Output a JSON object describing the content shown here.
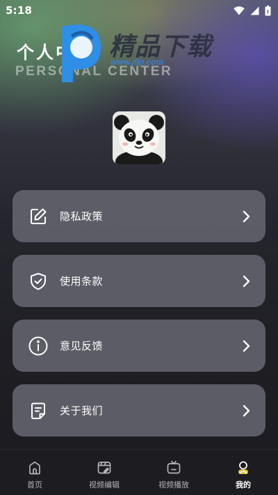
{
  "status_bar": {
    "time": "5:18"
  },
  "header": {
    "title": "个人中心",
    "subtitle": "PERSONAL CENTER"
  },
  "watermark": {
    "text": "精品下载",
    "url": "www.j9p.com"
  },
  "menu": [
    {
      "label": "隐私政策",
      "icon": "edit-icon"
    },
    {
      "label": "使用条款",
      "icon": "shield-check-icon"
    },
    {
      "label": "意见反馈",
      "icon": "info-icon"
    },
    {
      "label": "关于我们",
      "icon": "document-icon"
    }
  ],
  "nav": {
    "items": [
      {
        "label": "首页",
        "icon": "home-icon",
        "active": false
      },
      {
        "label": "视频编辑",
        "icon": "video-edit-icon",
        "active": false
      },
      {
        "label": "视频播放",
        "icon": "tv-icon",
        "active": false
      },
      {
        "label": "我的",
        "icon": "profile-icon",
        "active": true
      }
    ]
  },
  "colors": {
    "card": "#62626c",
    "nav_bg": "#1c1c21",
    "active": "#ffffff",
    "inactive": "#b5b5bb"
  }
}
